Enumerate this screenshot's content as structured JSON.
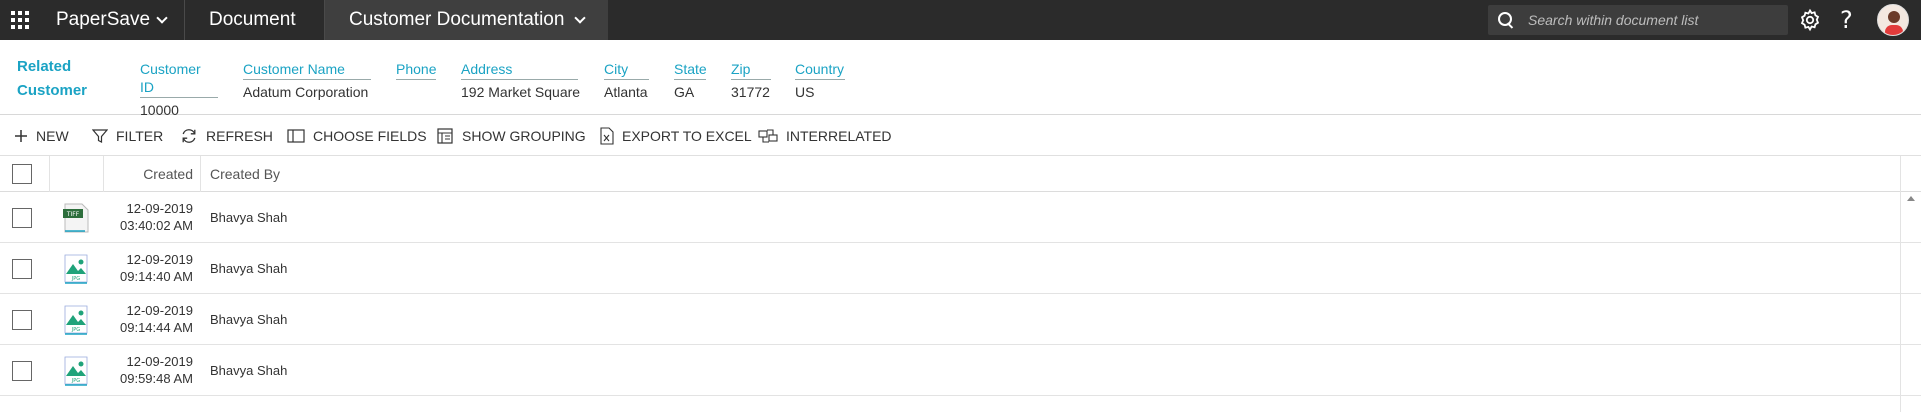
{
  "topbar": {
    "app_name": "PaperSave",
    "tabs": [
      {
        "label": "Document"
      },
      {
        "label": "Customer Documentation"
      }
    ],
    "search_placeholder": "Search within document list"
  },
  "related": {
    "title_line1": "Related",
    "title_line2": "Customer",
    "fields": [
      {
        "label": "Customer ID",
        "value": "10000"
      },
      {
        "label": "Customer Name",
        "value": "Adatum Corporation"
      },
      {
        "label": "Phone",
        "value": ""
      },
      {
        "label": "Address",
        "value": "192 Market Square"
      },
      {
        "label": "City",
        "value": "Atlanta"
      },
      {
        "label": "State",
        "value": "GA"
      },
      {
        "label": "Zip",
        "value": "31772"
      },
      {
        "label": "Country",
        "value": "US"
      }
    ]
  },
  "toolbar": {
    "new": "NEW",
    "filter": "FILTER",
    "refresh": "REFRESH",
    "choose_fields": "CHOOSE FIELDS",
    "show_grouping": "SHOW GROUPING",
    "export_excel": "EXPORT TO EXCEL",
    "interrelated": "INTERRELATED"
  },
  "grid": {
    "columns": {
      "created": "Created",
      "created_by": "Created By"
    },
    "rows": [
      {
        "file_type": "TIFF",
        "date": "12-09-2019",
        "time": "03:40:02 AM",
        "created_by": "Bhavya Shah"
      },
      {
        "file_type": "JPG",
        "date": "12-09-2019",
        "time": "09:14:40 AM",
        "created_by": "Bhavya Shah"
      },
      {
        "file_type": "JPG",
        "date": "12-09-2019",
        "time": "09:14:44 AM",
        "created_by": "Bhavya Shah"
      },
      {
        "file_type": "JPG",
        "date": "12-09-2019",
        "time": "09:59:48 AM",
        "created_by": "Bhavya Shah"
      }
    ]
  },
  "colors": {
    "topbar_bg": "#2b2b2b",
    "accent": "#1ba3c4",
    "jpg_icon": "#1fa37a"
  }
}
